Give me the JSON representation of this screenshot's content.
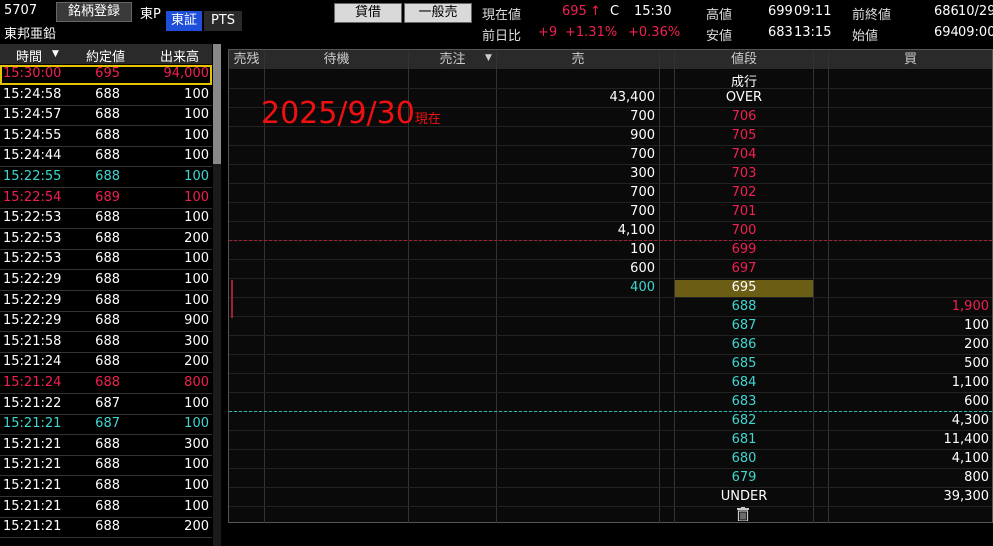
{
  "header": {
    "code": "5707",
    "register_label": "銘柄登録",
    "market_short": "東P",
    "name": "東邦亜鉛",
    "seg_tosho": "東証",
    "seg_pts": "PTS",
    "lend_label": "貸借",
    "account_label": "一般売",
    "current_label": "現在値",
    "current_price": "695",
    "current_arrow": "↑",
    "current_flag": "C",
    "current_time": "15:30",
    "prev_diff_label": "前日比",
    "diff": "+9",
    "diff_pct": "+1.31%",
    "diff_pct2": "+0.36%",
    "high_label": "高値",
    "high_value": "699",
    "high_time": "09:11",
    "low_label": "安値",
    "low_value": "683",
    "low_time": "13:15",
    "prev_close_label": "前終値",
    "prev_close_value": "686",
    "prev_close_date": "10/29",
    "open_label": "始値",
    "open_value": "694",
    "open_time": "09:00"
  },
  "ticks": {
    "headers": {
      "time": "時間",
      "price": "約定値",
      "volume": "出来高",
      "sort_icon": "▼"
    },
    "rows": [
      {
        "time": "15:30:00",
        "price": "695",
        "volume": "94,000",
        "color": "red",
        "highlight": true
      },
      {
        "time": "15:24:58",
        "price": "688",
        "volume": "100",
        "color": "white"
      },
      {
        "time": "15:24:57",
        "price": "688",
        "volume": "100",
        "color": "white"
      },
      {
        "time": "15:24:55",
        "price": "688",
        "volume": "100",
        "color": "white"
      },
      {
        "time": "15:24:44",
        "price": "688",
        "volume": "100",
        "color": "white"
      },
      {
        "time": "15:22:55",
        "price": "688",
        "volume": "100",
        "color": "cyan"
      },
      {
        "time": "15:22:54",
        "price": "689",
        "volume": "100",
        "color": "red"
      },
      {
        "time": "15:22:53",
        "price": "688",
        "volume": "100",
        "color": "white"
      },
      {
        "time": "15:22:53",
        "price": "688",
        "volume": "200",
        "color": "white"
      },
      {
        "time": "15:22:53",
        "price": "688",
        "volume": "100",
        "color": "white"
      },
      {
        "time": "15:22:29",
        "price": "688",
        "volume": "100",
        "color": "white"
      },
      {
        "time": "15:22:29",
        "price": "688",
        "volume": "100",
        "color": "white"
      },
      {
        "time": "15:22:29",
        "price": "688",
        "volume": "900",
        "color": "white"
      },
      {
        "time": "15:21:58",
        "price": "688",
        "volume": "300",
        "color": "white"
      },
      {
        "time": "15:21:24",
        "price": "688",
        "volume": "200",
        "color": "white"
      },
      {
        "time": "15:21:24",
        "price": "688",
        "volume": "800",
        "color": "red"
      },
      {
        "time": "15:21:22",
        "price": "687",
        "volume": "100",
        "color": "white"
      },
      {
        "time": "15:21:21",
        "price": "687",
        "volume": "100",
        "color": "cyan"
      },
      {
        "time": "15:21:21",
        "price": "688",
        "volume": "300",
        "color": "white"
      },
      {
        "time": "15:21:21",
        "price": "688",
        "volume": "100",
        "color": "white"
      },
      {
        "time": "15:21:21",
        "price": "688",
        "volume": "100",
        "color": "white"
      },
      {
        "time": "15:21:21",
        "price": "688",
        "volume": "100",
        "color": "white"
      },
      {
        "time": "15:21:21",
        "price": "688",
        "volume": "200",
        "color": "white"
      }
    ]
  },
  "board": {
    "headers": {
      "sell_remain": "売残",
      "waiting": "待機",
      "sell_order": "売注",
      "sell_order_icon": "▼",
      "sell": "売",
      "price": "値段",
      "buy": "買"
    },
    "rows": [
      {
        "sell": "",
        "price": "成行",
        "price_color": "white",
        "buy": ""
      },
      {
        "sell": "43,400",
        "price": "OVER",
        "price_color": "white",
        "buy": ""
      },
      {
        "sell": "700",
        "price": "706",
        "price_color": "red",
        "buy": ""
      },
      {
        "sell": "900",
        "price": "705",
        "price_color": "red",
        "buy": ""
      },
      {
        "sell": "700",
        "price": "704",
        "price_color": "red",
        "buy": ""
      },
      {
        "sell": "300",
        "price": "703",
        "price_color": "red",
        "buy": ""
      },
      {
        "sell": "700",
        "price": "702",
        "price_color": "red",
        "buy": ""
      },
      {
        "sell": "700",
        "price": "701",
        "price_color": "red",
        "buy": ""
      },
      {
        "sell": "4,100",
        "price": "700",
        "price_color": "red",
        "buy": ""
      },
      {
        "sell": "100",
        "price": "699",
        "price_color": "red",
        "buy": ""
      },
      {
        "sell": "600",
        "price": "697",
        "price_color": "red",
        "buy": ""
      },
      {
        "sell": "400",
        "price": "695",
        "price_color": "white",
        "buy": "",
        "sell_color": "cyan",
        "current": true
      },
      {
        "sell": "",
        "price": "688",
        "price_color": "cyan",
        "buy": "1,900",
        "buy_color": "red"
      },
      {
        "sell": "",
        "price": "687",
        "price_color": "cyan",
        "buy": "100"
      },
      {
        "sell": "",
        "price": "686",
        "price_color": "cyan",
        "buy": "200"
      },
      {
        "sell": "",
        "price": "685",
        "price_color": "cyan",
        "buy": "500"
      },
      {
        "sell": "",
        "price": "684",
        "price_color": "cyan",
        "buy": "1,100"
      },
      {
        "sell": "",
        "price": "683",
        "price_color": "cyan",
        "buy": "600"
      },
      {
        "sell": "",
        "price": "682",
        "price_color": "cyan",
        "buy": "4,300"
      },
      {
        "sell": "",
        "price": "681",
        "price_color": "cyan",
        "buy": "11,400"
      },
      {
        "sell": "",
        "price": "680",
        "price_color": "cyan",
        "buy": "4,100"
      },
      {
        "sell": "",
        "price": "679",
        "price_color": "cyan",
        "buy": "800"
      },
      {
        "sell": "",
        "price": "UNDER",
        "price_color": "white",
        "buy": "39,300"
      }
    ],
    "stamp_date": "2025/9/30",
    "stamp_suffix": "現在",
    "trash_icon": "trash-icon"
  },
  "colors": {
    "up": "#f02050",
    "down": "#3fd6d0",
    "accent": "#1f4fd8",
    "highlight": "#e6c200",
    "current_bg": "#6b5e14"
  }
}
